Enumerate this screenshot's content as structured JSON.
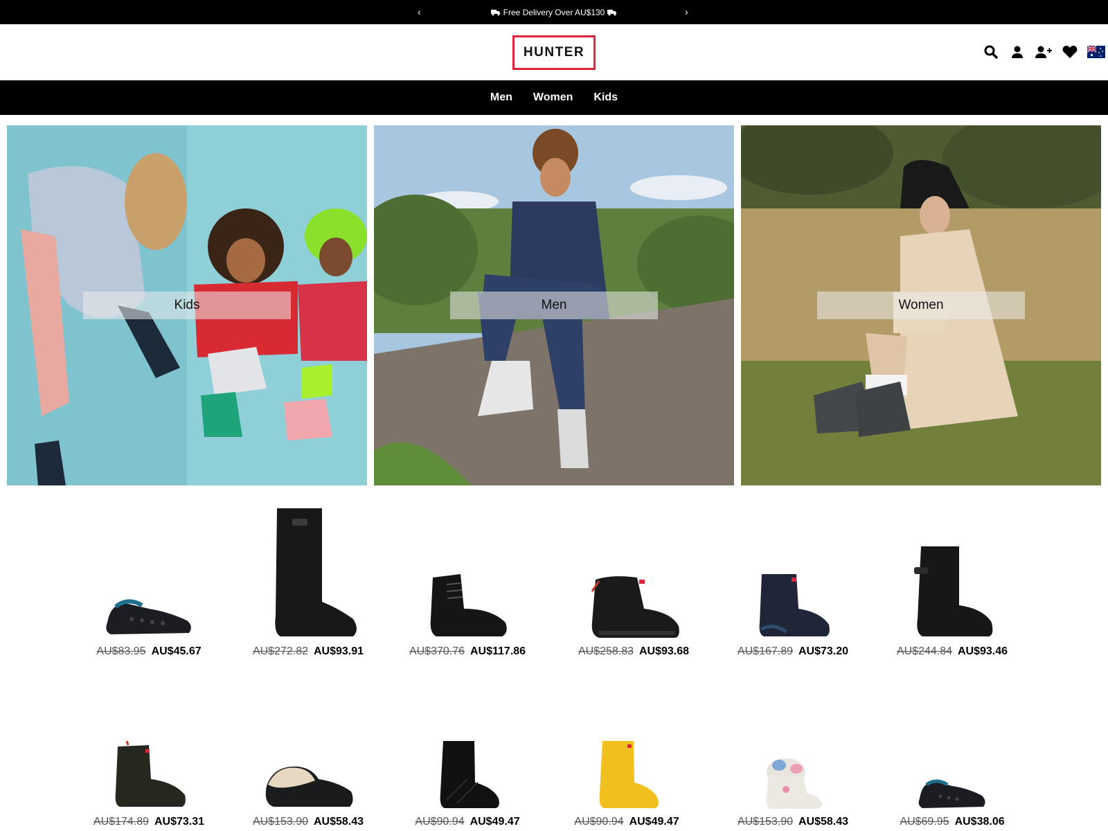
{
  "promo": {
    "message": "Free Delivery Over AU$130",
    "prev_icon": "chevron-left-icon",
    "next_icon": "chevron-right-icon"
  },
  "header": {
    "logo_text": "HUNTER",
    "brand_color": "#e0223a",
    "icons": [
      "search-icon",
      "account-icon",
      "add-user-icon",
      "wishlist-heart-icon",
      "australia-flag-icon"
    ]
  },
  "nav": {
    "items": [
      "Men",
      "Women",
      "Kids"
    ]
  },
  "hero": {
    "tiles": [
      {
        "label": "Kids"
      },
      {
        "label": "Men"
      },
      {
        "label": "Women"
      }
    ]
  },
  "products": [
    {
      "old_price": "AU$83.95",
      "price": "AU$45.67"
    },
    {
      "old_price": "AU$272.82",
      "price": "AU$93.91"
    },
    {
      "old_price": "AU$370.76",
      "price": "AU$117.86"
    },
    {
      "old_price": "AU$258.83",
      "price": "AU$93.68"
    },
    {
      "old_price": "AU$167.89",
      "price": "AU$73.20"
    },
    {
      "old_price": "AU$244.84",
      "price": "AU$93.46"
    },
    {
      "old_price": "AU$174.89",
      "price": "AU$73.31"
    },
    {
      "old_price": "AU$153.90",
      "price": "AU$58.43"
    },
    {
      "old_price": "AU$90.94",
      "price": "AU$49.47"
    },
    {
      "old_price": "AU$90.94",
      "price": "AU$49.47"
    },
    {
      "old_price": "AU$153.90",
      "price": "AU$58.43"
    },
    {
      "old_price": "AU$69.95",
      "price": "AU$38.06"
    }
  ]
}
